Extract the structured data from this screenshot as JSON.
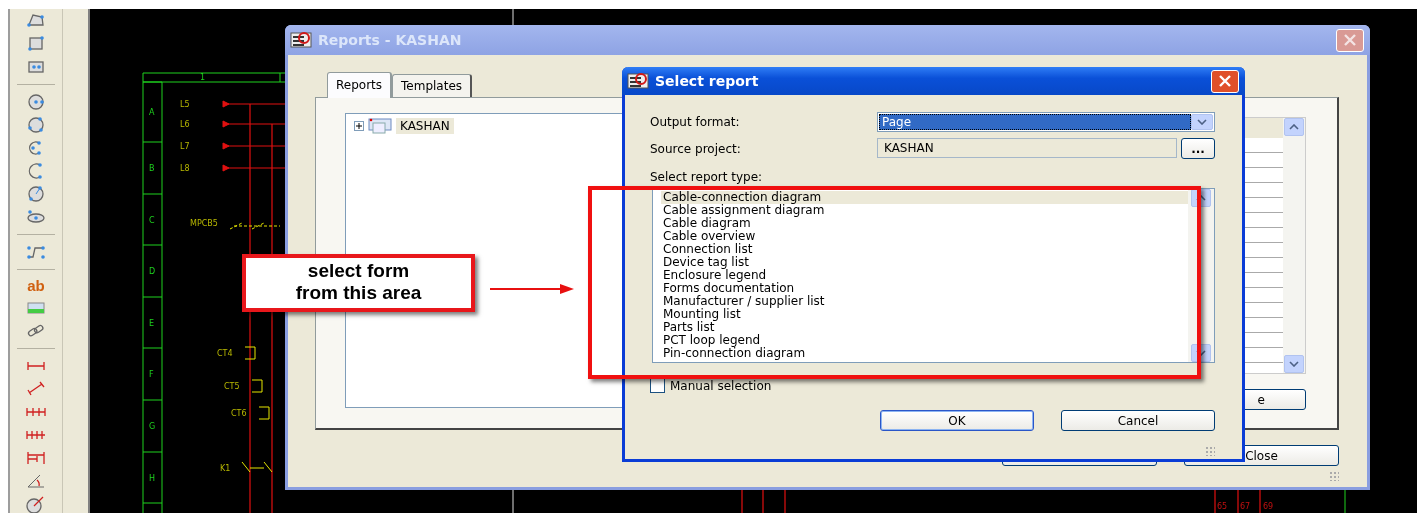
{
  "toolbar": [
    {
      "kind": "polygon"
    },
    {
      "kind": "rectangle"
    },
    {
      "kind": "rect-center"
    },
    {
      "kind": "separator"
    },
    {
      "kind": "circle"
    },
    {
      "kind": "circle-points"
    },
    {
      "kind": "arc"
    },
    {
      "kind": "arc-open"
    },
    {
      "kind": "sector"
    },
    {
      "kind": "ellipse"
    },
    {
      "kind": "separator"
    },
    {
      "kind": "polyline"
    },
    {
      "kind": "separator"
    },
    {
      "kind": "text",
      "label": "ab"
    },
    {
      "kind": "image"
    },
    {
      "kind": "link"
    },
    {
      "kind": "separator"
    },
    {
      "kind": "dimension"
    },
    {
      "kind": "dimension-aligned"
    },
    {
      "kind": "dimension-chain"
    },
    {
      "kind": "dimension-incremental"
    },
    {
      "kind": "dimension-base"
    },
    {
      "kind": "angle"
    },
    {
      "kind": "radius"
    }
  ],
  "schematic": {
    "column_label": "1",
    "rows": [
      "A",
      "B",
      "C",
      "D",
      "E",
      "F",
      "G",
      "H"
    ],
    "terminals": [
      "L5",
      "L6",
      "L7",
      "L8"
    ],
    "devices": [
      {
        "text": "MPCB5",
        "kind": "breaker"
      },
      {
        "text": "CT4",
        "kind": "ct"
      },
      {
        "text": "CT5",
        "kind": "ct"
      },
      {
        "text": "CT6",
        "kind": "ct"
      },
      {
        "text": "K1",
        "kind": "contact"
      }
    ],
    "wire_numbers": [
      "65",
      "67",
      "69"
    ]
  },
  "reports_window": {
    "title": "Reports - KASHAN",
    "tabs": [
      {
        "label": "Reports",
        "selected": true
      },
      {
        "label": "Templates",
        "selected": false
      }
    ],
    "tree": [
      {
        "label": "KASHAN",
        "expanded": false,
        "selected": true
      }
    ],
    "side_button": "e",
    "buttons": [
      "Close"
    ]
  },
  "select_window": {
    "title": "Select report",
    "fields": [
      {
        "kind": "dropdown",
        "label": "Output format:",
        "value": "Page"
      },
      {
        "kind": "browse",
        "label": "Source project:",
        "value": "KASHAN",
        "button": "..."
      }
    ],
    "list_label": "Select report type:",
    "report_types": [
      {
        "label": "Cable-connection diagram",
        "selected": true
      },
      {
        "label": "Cable assignment diagram",
        "selected": false
      },
      {
        "label": "Cable diagram",
        "selected": false
      },
      {
        "label": "Cable overview",
        "selected": false
      },
      {
        "label": "Connection list",
        "selected": false
      },
      {
        "label": "Device tag list",
        "selected": false
      },
      {
        "label": "Enclosure legend",
        "selected": false
      },
      {
        "label": "Forms documentation",
        "selected": false
      },
      {
        "label": "Manufacturer / supplier list",
        "selected": false
      },
      {
        "label": "Mounting list",
        "selected": false
      },
      {
        "label": "Parts list",
        "selected": false
      },
      {
        "label": "PCT loop legend",
        "selected": false
      },
      {
        "label": "Pin-connection diagram",
        "selected": false
      }
    ],
    "manual_selection": {
      "label": "Manual selection",
      "checked": false
    },
    "buttons": [
      {
        "label": "OK",
        "default": true
      },
      {
        "label": "Cancel",
        "default": false
      }
    ]
  },
  "callout": {
    "text": "select form\nfrom this area"
  }
}
